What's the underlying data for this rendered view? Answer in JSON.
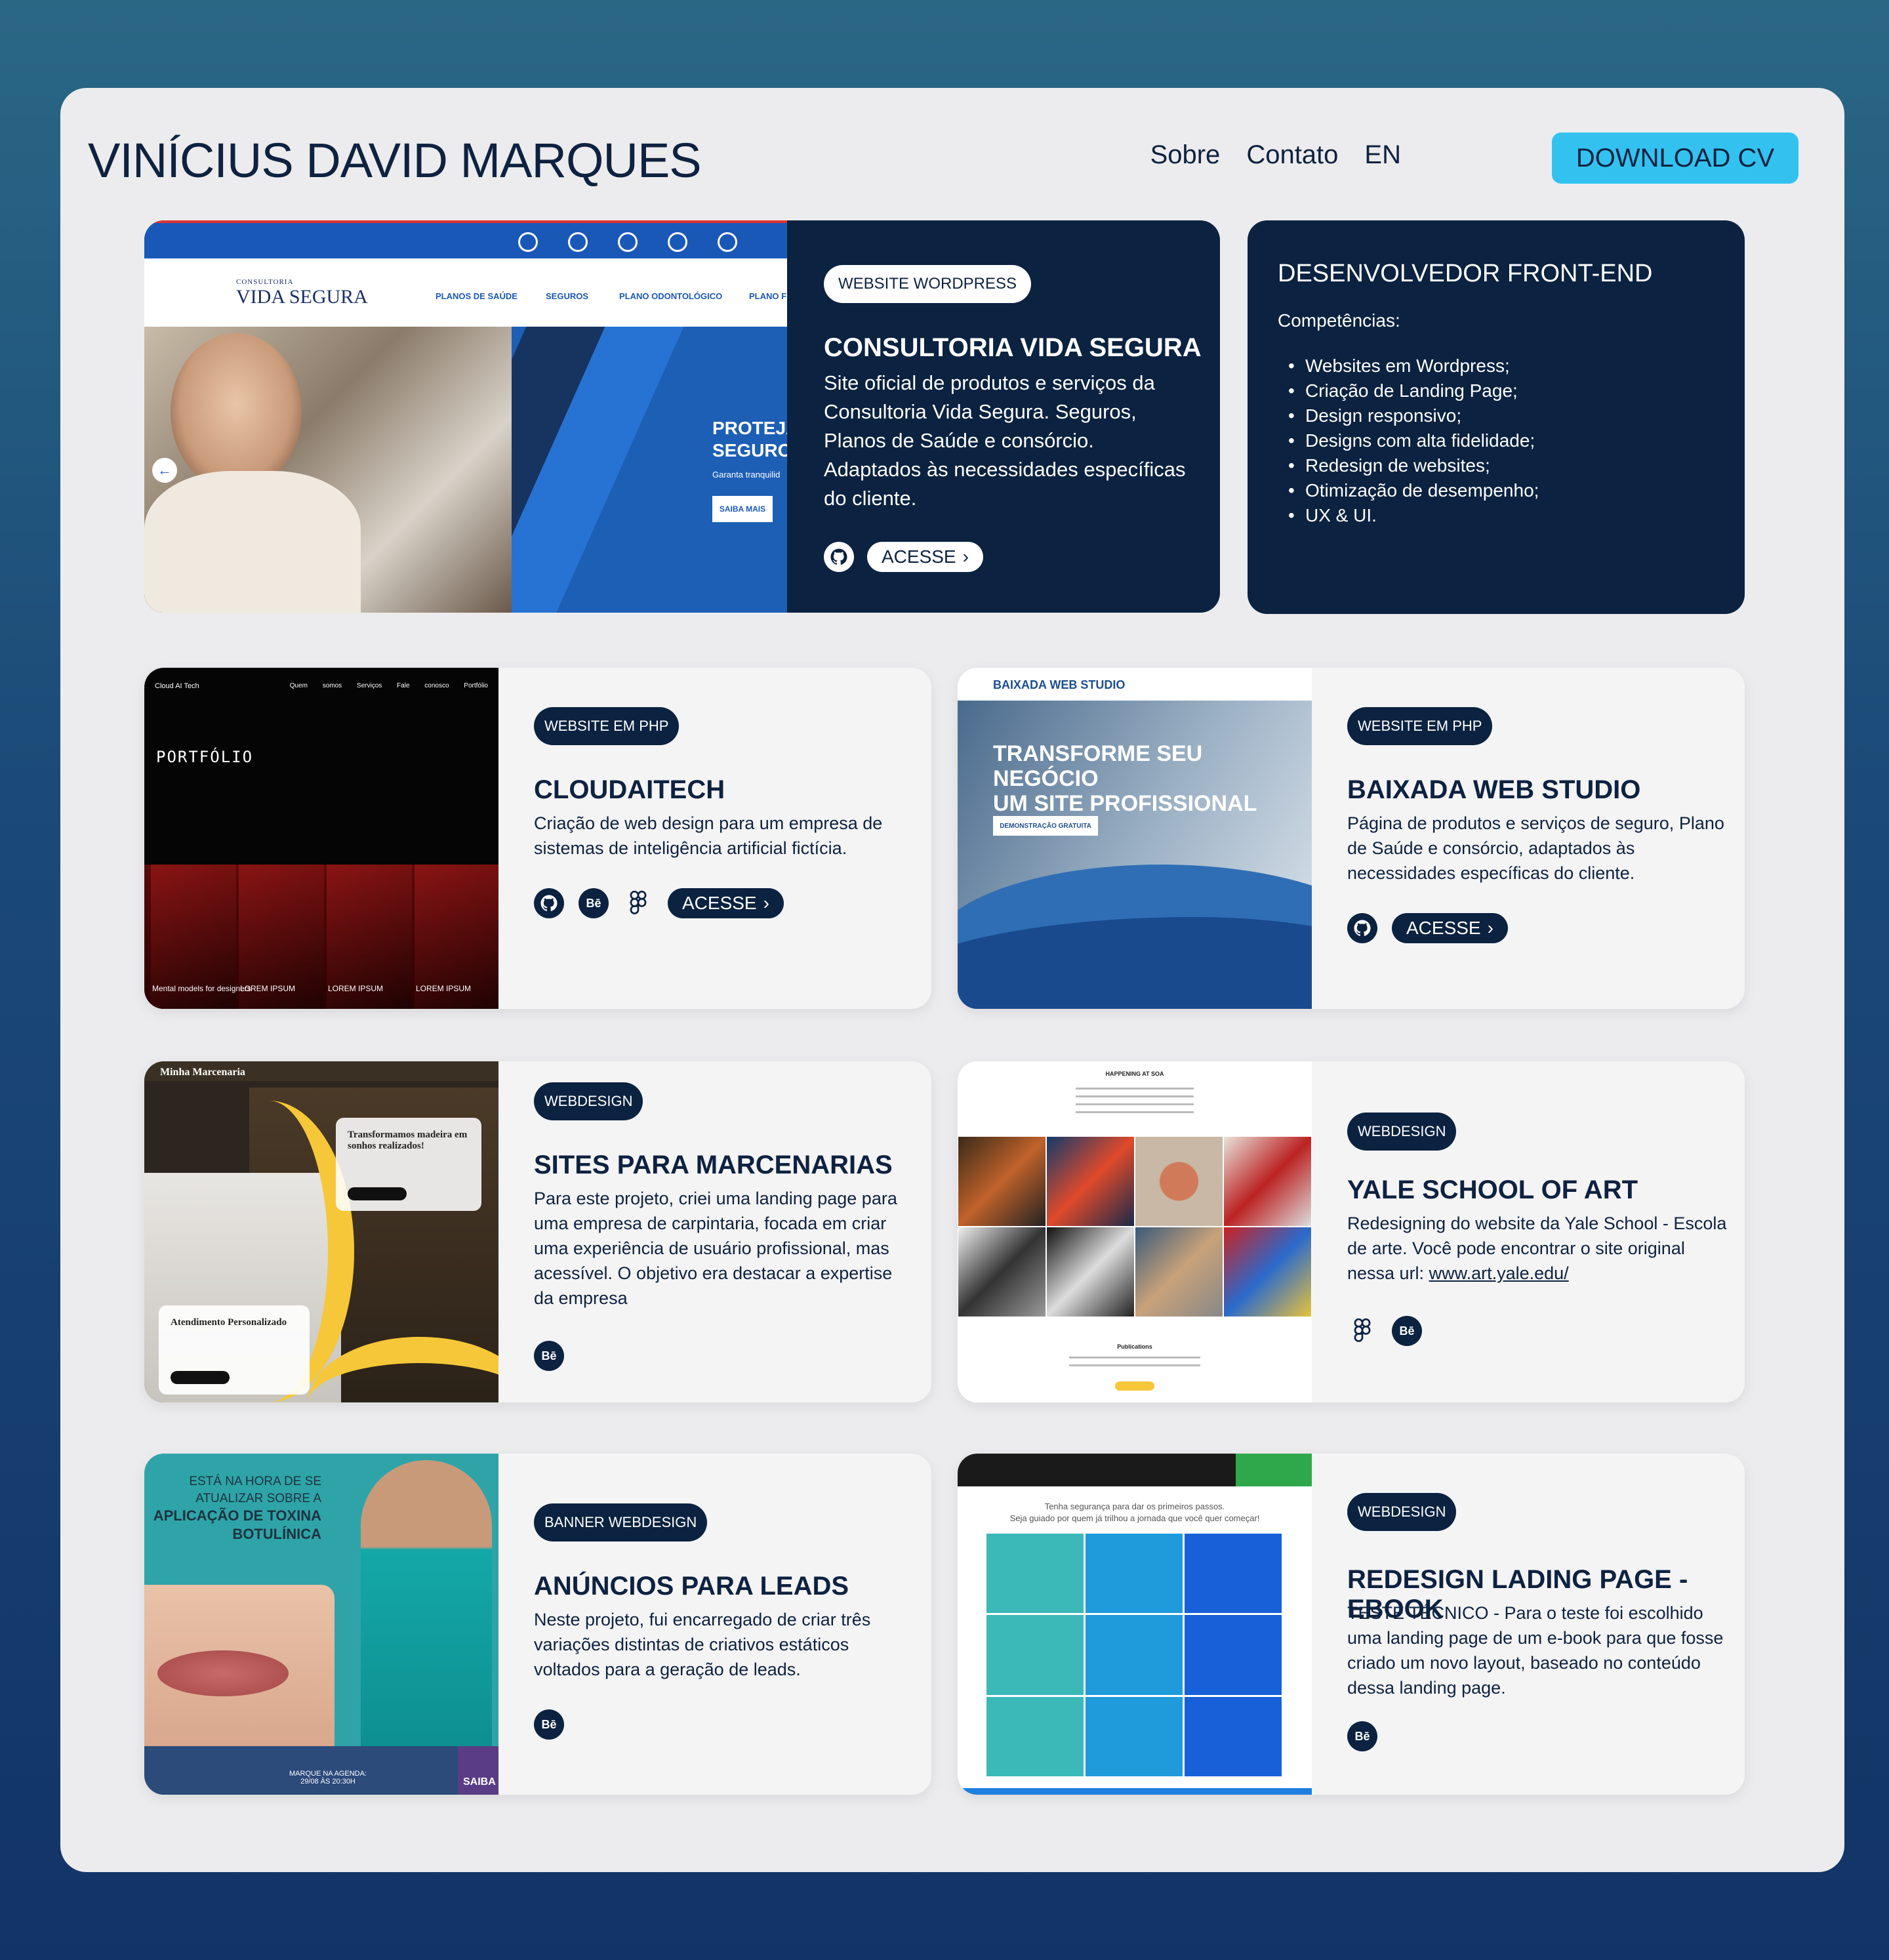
{
  "header": {
    "name": "VINÍCIUS DAVID MARQUES",
    "nav": [
      "Sobre",
      "Contato",
      "EN"
    ],
    "cv_button": "DOWNLOAD CV"
  },
  "featured": {
    "tag": "WEBSITE WORDPRESS",
    "title": "CONSULTORIA VIDA SEGURA",
    "description": "Site oficial de produtos e serviços da Consultoria Vida Segura. Seguros, Planos de Saúde e consórcio. Adaptados às necessidades específicas do cliente.",
    "link_label": "ACESSE",
    "thumb": {
      "logo_small": "CONSULTORIA",
      "logo": "VIDA SEGURA",
      "menu": [
        "PLANOS DE SAÚDE",
        "SEGUROS",
        "PLANO ODONTOLÓGICO",
        "PLANO F"
      ],
      "hero_line1": "PROTEJA",
      "hero_line2": "SEGUROS",
      "hero_sub": "Garanta tranquilid",
      "hero_button": "SAIBA MAIS"
    }
  },
  "skills": {
    "title": "DESENVOLVEDOR FRONT-END",
    "subtitle": "Competências:",
    "items": [
      "Websites em Wordpress;",
      "Criação de Landing Page;",
      "Design responsivo;",
      "Designs com alta fidelidade;",
      "Redesign de websites;",
      "Otimização de desempenho;",
      "UX & UI."
    ]
  },
  "projects": [
    {
      "tag": "WEBSITE EM PHP",
      "title": "CLOUDAITECH",
      "description": "Criação de web design para um empresa de sistemas de inteligência artificial fictícia.",
      "link_label": "ACESSE",
      "thumb": {
        "brand": "Cloud AI Tech",
        "menu": "Quem somos Serviços Fale conosco Portfólio",
        "heading": "PORTFÓLIO",
        "labels": [
          "Mental models for designers",
          "LOREM IPSUM",
          "LOREM IPSUM",
          "LOREM IPSUM"
        ]
      }
    },
    {
      "tag": "WEBSITE EM PHP",
      "title": "BAIXADA WEB STUDIO",
      "description": "Página de produtos e serviços de seguro, Plano de Saúde e consórcio, adaptados às necessidades específicas do cliente.",
      "link_label": "ACESSE",
      "thumb": {
        "brand": "BAIXADA WEB STUDIO",
        "heading1": "TRANSFORME SEU NEGÓCIO",
        "heading2": "UM SITE PROFISSIONAL",
        "button": "DEMONSTRAÇÃO GRATUITA"
      }
    },
    {
      "tag": "WEBDESIGN",
      "title": "SITES PARA MARCENARIAS",
      "description": "Para este projeto, criei uma landing page para uma empresa de carpintaria, focada em criar uma experiência de usuário profissional, mas acessível. O objetivo era destacar a expertise da empresa",
      "thumb": {
        "brand": "Minha Marcenaria",
        "box1": "Transformamos madeira em sonhos realizados!",
        "box2": "Atendimento Personalizado"
      }
    },
    {
      "tag": "WEBDESIGN",
      "title": "YALE SCHOOL OF ART",
      "description": "Redesigning do website da Yale School - Escola de arte. Você pode encontrar o site original nessa url:",
      "url": "www.art.yale.edu/",
      "thumb": {
        "heading": "HAPPENING AT SOA",
        "section": "Publications"
      }
    },
    {
      "tag": "BANNER WEBDESIGN",
      "title": "ANÚNCIOS PARA LEADS",
      "description": "Neste projeto, fui encarregado de criar três variações distintas de criativos estáticos voltados para a geração de leads.",
      "thumb": {
        "line1": "ESTÁ NA HORA DE SE",
        "line2": "ATUALIZAR SOBRE A",
        "line3": "APLICAÇÃO DE TOXINA",
        "line4": "BOTULÍNICA",
        "date1": "MARQUE NA AGENDA:",
        "date2": "29/08 ÀS 20:30H",
        "side": "SAIBA"
      }
    },
    {
      "tag": "WEBDESIGN",
      "title": "REDESIGN LADING PAGE - EBOOK",
      "description": "TESTE TÉCNICO - Para o teste foi escolhido uma landing page de um e-book para que fosse criado um novo layout, baseado no conteúdo dessa landing page.",
      "thumb": {
        "line1": "Tenha segurança para dar os primeiros passos.",
        "line2": "Seja guiado por quem já trilhou a jornada que você quer começar!"
      }
    }
  ],
  "colors": {
    "navy": "#0b2240",
    "accent": "#33c2ef",
    "card": "#f4f4f5"
  }
}
